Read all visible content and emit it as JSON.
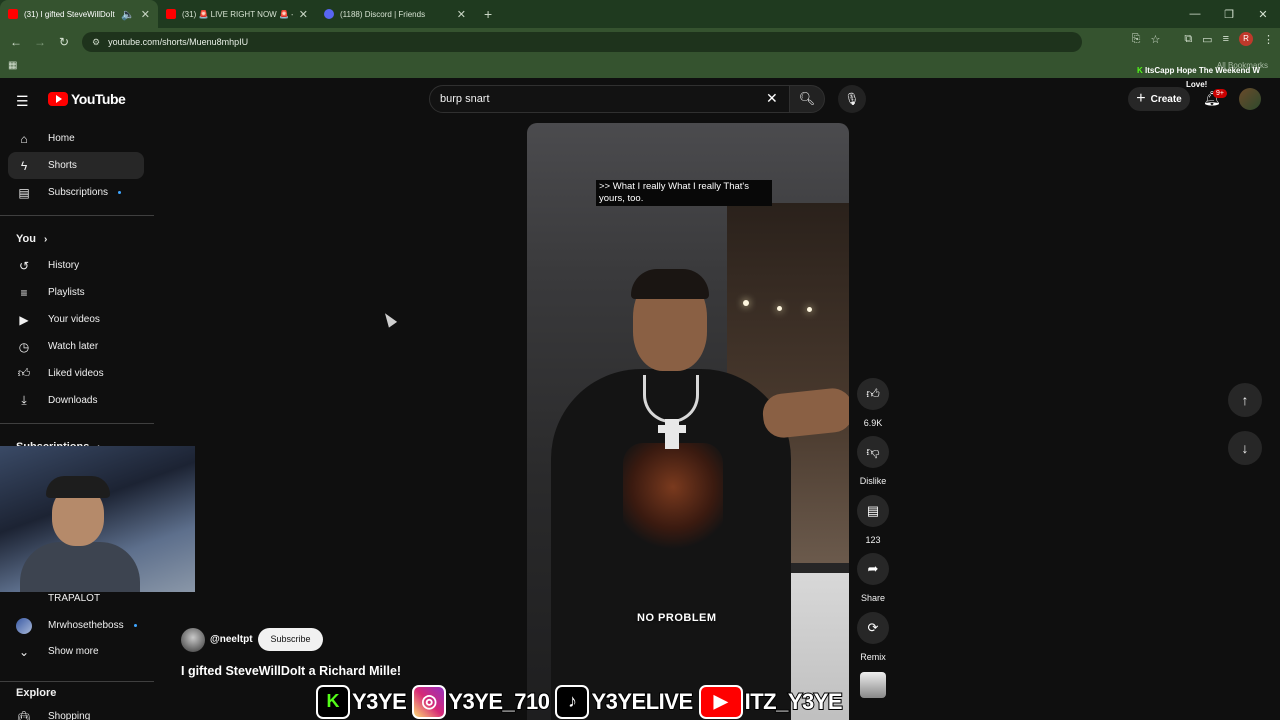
{
  "browser": {
    "tabs": [
      {
        "title": "(31) I gifted SteveWillDoIt a",
        "color": "#ff0000"
      },
      {
        "title": "(31) 🚨 LIVE RIGHT NOW 🚨 -",
        "color": "#ff0000"
      },
      {
        "title": "(1188) Discord | Friends",
        "color": "#5865f2"
      }
    ],
    "url": "youtube.com/shorts/Muenu8mhpIU",
    "profile_initial": "R",
    "all_bookmarks": "All Bookmarks"
  },
  "overlay": {
    "ticker_brand": "ItsCapp",
    "ticker_text": "Hope The Weekend W",
    "love": "Love!"
  },
  "header": {
    "logo_text": "YouTube",
    "search_value": "burp snart",
    "create_label": "Create",
    "notif_badge": "9+"
  },
  "sidebar": {
    "items": [
      {
        "label": "Home",
        "icon": "home-icon"
      },
      {
        "label": "Shorts",
        "icon": "shorts-icon"
      },
      {
        "label": "Subscriptions",
        "icon": "subscriptions-icon"
      }
    ],
    "you_heading": "You",
    "you_items": [
      {
        "label": "History",
        "icon": "history-icon"
      },
      {
        "label": "Playlists",
        "icon": "playlists-icon"
      },
      {
        "label": "Your videos",
        "icon": "your-videos-icon"
      },
      {
        "label": "Watch later",
        "icon": "watch-later-icon"
      },
      {
        "label": "Liked videos",
        "icon": "liked-videos-icon"
      },
      {
        "label": "Downloads",
        "icon": "downloads-icon"
      }
    ],
    "subs_heading": "Subscriptions",
    "subs": [
      {
        "label": "TRAPALOT"
      },
      {
        "label": "Mrwhosetheboss"
      }
    ],
    "show_more": "Show more",
    "explore_heading": "Explore",
    "explore_items": [
      {
        "label": "Shopping"
      }
    ]
  },
  "video": {
    "caption_top": ">> What I really What I really That's yours, too.",
    "caption_bottom": "NO PROBLEM",
    "channel": "@neeltpt",
    "subscribe_label": "Subscribe",
    "title": "I gifted SteveWillDoIt a Richard Mille!"
  },
  "actions": {
    "likes": "6.9K",
    "dislike": "Dislike",
    "comments": "123",
    "share": "Share",
    "remix": "Remix"
  },
  "socials": [
    {
      "platform": "kick",
      "handle": "Y3YE"
    },
    {
      "platform": "instagram",
      "handle": "Y3YE_710"
    },
    {
      "platform": "tiktok",
      "handle": "Y3YELIVE"
    },
    {
      "platform": "youtube",
      "handle": "ITZ_Y3YE"
    }
  ]
}
